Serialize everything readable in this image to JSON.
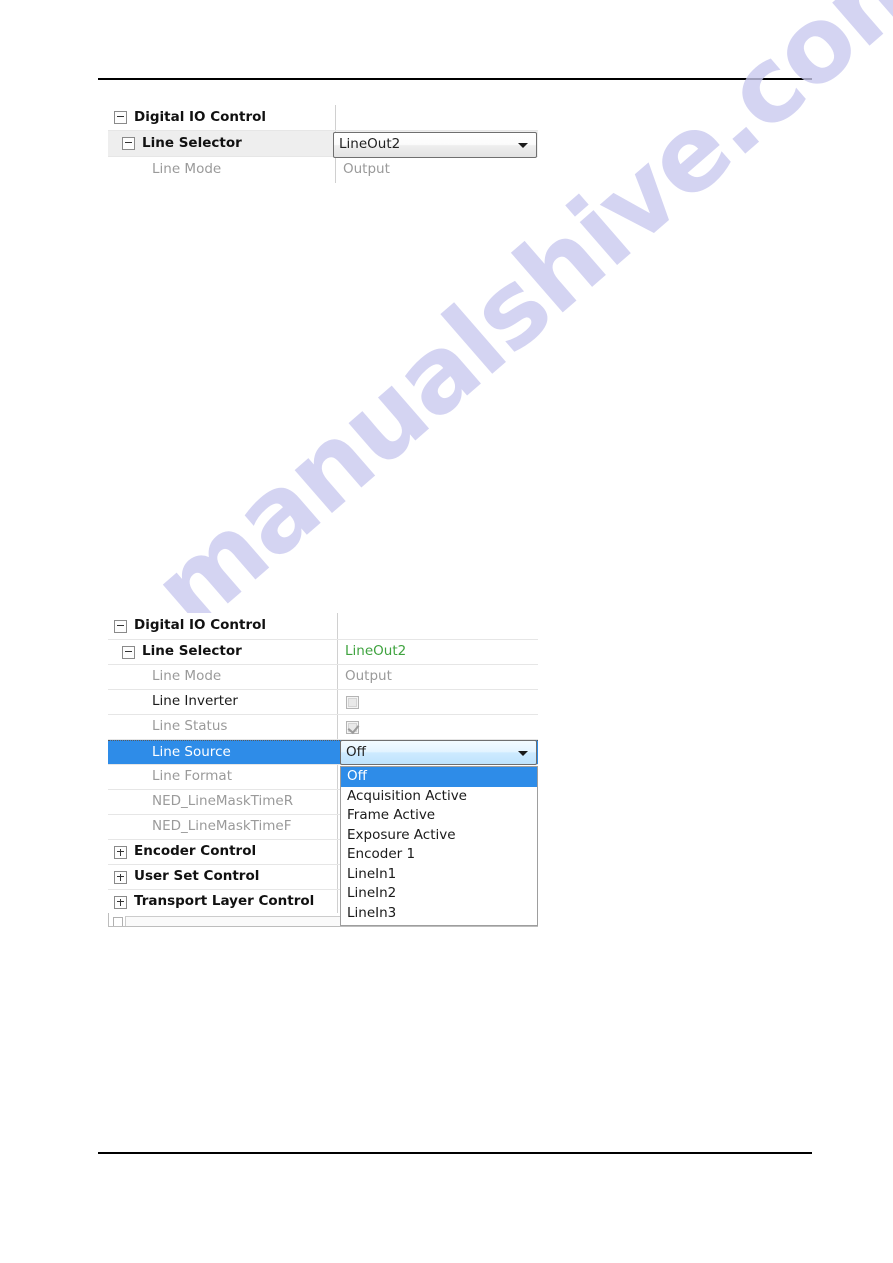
{
  "document": {
    "watermark_text": "manualshive.com",
    "rules": {
      "top": "horizontal-rule",
      "bottom": "horizontal-rule"
    }
  },
  "colors": {
    "selection_blue": "#2e8ce8",
    "value_green": "#3fa33f",
    "disabled_gray": "#9a9a9a",
    "row_hover_gray": "#eeeeee",
    "watermark": "#c9c9ef"
  },
  "panel_top": {
    "name": "digital-io-control-collapsed-panel",
    "rows": [
      {
        "label": "Digital IO Control",
        "value": "",
        "expander": "minus",
        "indent": 0,
        "style": "bold",
        "value_style": "none"
      },
      {
        "label": "Line Selector",
        "value": "LineOut2",
        "expander": "minus",
        "indent": 1,
        "style": "bold",
        "value_style": "combo",
        "row_highlight": "gray"
      },
      {
        "label": "Line Mode",
        "value": "Output",
        "expander": "none",
        "indent": 2,
        "style": "dim",
        "value_style": "dim"
      }
    ],
    "combo": {
      "value": "LineOut2",
      "state": "normal",
      "caret": "chevron-down-icon"
    }
  },
  "panel_bottom": {
    "name": "digital-io-control-expanded-panel",
    "rows": [
      {
        "label": "Digital IO Control",
        "value": "",
        "expander": "minus",
        "indent": 0,
        "style": "bold",
        "value_style": "none"
      },
      {
        "label": "Line Selector",
        "value": "LineOut2",
        "expander": "minus",
        "indent": 1,
        "style": "bold",
        "value_style": "green"
      },
      {
        "label": "Line Mode",
        "value": "Output",
        "expander": "none",
        "indent": 2,
        "style": "dim",
        "value_style": "dim"
      },
      {
        "label": "Line Inverter",
        "value": "",
        "expander": "none",
        "indent": 2,
        "style": "normal",
        "value_style": "checkbox-unchecked"
      },
      {
        "label": "Line Status",
        "value": "",
        "expander": "none",
        "indent": 2,
        "style": "dim",
        "value_style": "checkbox-checked"
      },
      {
        "label": "Line Source",
        "value": "Off",
        "expander": "none",
        "indent": 2,
        "style": "normal",
        "value_style": "combo-open",
        "row_highlight": "blue"
      },
      {
        "label": "Line Format",
        "value": "",
        "expander": "none",
        "indent": 2,
        "style": "dim",
        "value_style": "none"
      },
      {
        "label": "NED_LineMaskTimeR",
        "value": "",
        "expander": "none",
        "indent": 2,
        "style": "dim",
        "value_style": "none"
      },
      {
        "label": "NED_LineMaskTimeF",
        "value": "",
        "expander": "none",
        "indent": 2,
        "style": "dim",
        "value_style": "none"
      },
      {
        "label": "Encoder Control",
        "value": "",
        "expander": "plus",
        "indent": 0,
        "style": "bold",
        "value_style": "none"
      },
      {
        "label": "User Set Control",
        "value": "",
        "expander": "plus",
        "indent": 0,
        "style": "bold",
        "value_style": "none"
      },
      {
        "label": "Transport Layer Control",
        "value": "",
        "expander": "plus",
        "indent": 0,
        "style": "bold",
        "value_style": "none"
      }
    ],
    "combo": {
      "value": "Off",
      "state": "open",
      "caret": "chevron-down-icon"
    },
    "dropdown": {
      "selected": "Off",
      "options": [
        "Off",
        "Acquisition Active",
        "Frame Active",
        "Exposure Active",
        "Encoder 1",
        "LineIn1",
        "LineIn2",
        "LineIn3"
      ]
    }
  }
}
